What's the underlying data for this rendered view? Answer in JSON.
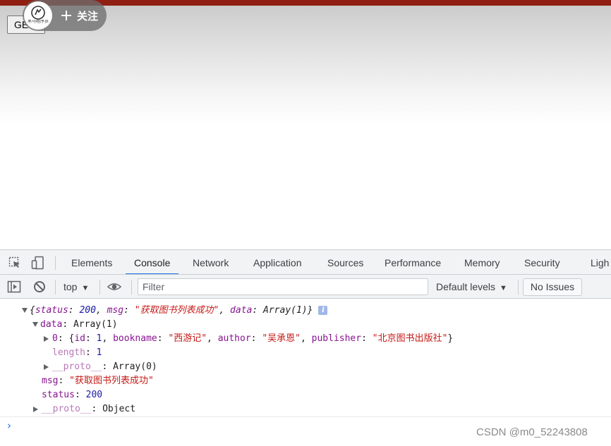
{
  "page": {
    "get_button_label": "GE",
    "follow_button_label": "关注",
    "avatar_text": "黑马程序员",
    "colors": {
      "top_strip": "#8f1f12"
    }
  },
  "devtools": {
    "tabs": [
      {
        "label": "Elements",
        "active": false
      },
      {
        "label": "Console",
        "active": true
      },
      {
        "label": "Network",
        "active": false
      },
      {
        "label": "Application",
        "active": false
      },
      {
        "label": "Sources",
        "active": false
      },
      {
        "label": "Performance",
        "active": false
      },
      {
        "label": "Memory",
        "active": false
      },
      {
        "label": "Security",
        "active": false
      },
      {
        "label": "Ligh",
        "active": false
      }
    ],
    "toolbar_icons": [
      "inspect-element-icon",
      "device-toolbar-icon"
    ],
    "filterbar": {
      "icons": [
        "sidebar-toggle-icon",
        "clear-console-icon",
        "eye-icon"
      ],
      "context": "top",
      "filter_placeholder": "Filter",
      "levels": "Default levels",
      "issues": "No Issues"
    },
    "accent_color": "#1a73e8"
  },
  "console": {
    "root": {
      "open": "{",
      "status_key": "status",
      "status_val": "200",
      "msg_key": "msg",
      "msg_val": "\"获取图书列表成功\"",
      "data_key": "data",
      "data_val": "Array(1)",
      "close": "}"
    },
    "data_line": {
      "key": "data",
      "val": "Array(1)"
    },
    "item_line": {
      "index": "0",
      "id_key": "id",
      "id_val": "1",
      "bookname_key": "bookname",
      "bookname_val": "\"西游记\"",
      "author_key": "author",
      "author_val": "\"吴承恩\"",
      "publisher_key": "publisher",
      "publisher_val": "\"北京图书出版社\""
    },
    "length_line": {
      "key": "length",
      "val": "1"
    },
    "array_proto_line": {
      "key": "__proto__",
      "val": "Array(0)"
    },
    "msg_line": {
      "key": "msg",
      "val": "\"获取图书列表成功\""
    },
    "status_line": {
      "key": "status",
      "val": "200"
    },
    "object_proto_line": {
      "key": "__proto__",
      "val": "Object"
    },
    "prompt": "›"
  },
  "watermark": "CSDN @m0_52243808"
}
